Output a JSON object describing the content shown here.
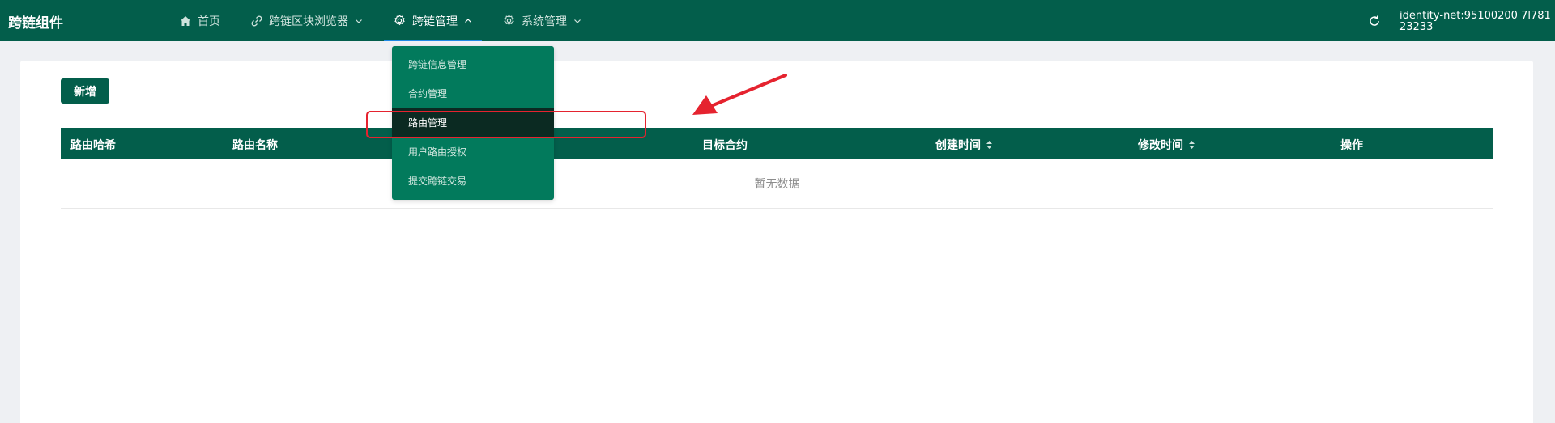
{
  "topbar": {
    "brand": "跨链组件",
    "nav": [
      {
        "label": "首页",
        "icon": "home-icon"
      },
      {
        "label": "跨链区块浏览器",
        "icon": "link-icon"
      },
      {
        "label": "跨链管理",
        "icon": "gear-icon"
      },
      {
        "label": "系统管理",
        "icon": "gear-icon"
      }
    ],
    "identity": "identity-net:95100200 7l78123233",
    "refresh_icon": "refresh-icon"
  },
  "toolbar": {
    "add_label": "新增"
  },
  "table": {
    "columns": [
      "路由哈希",
      "路由名称",
      "目标合约",
      "创建时间",
      "修改时间",
      "操作"
    ],
    "empty_text": "暂无数据"
  },
  "dropdown": {
    "items": [
      "跨链信息管理",
      "合约管理",
      "路由管理",
      "用户路由授权",
      "提交跨链交易"
    ],
    "selected": "路由管理"
  },
  "colors": {
    "primary": "#035e4b",
    "dropdown_bg": "#027a5c",
    "selected_bg": "#0b2a22",
    "annotation": "#e5232f",
    "active_underline": "#1e88e5"
  }
}
